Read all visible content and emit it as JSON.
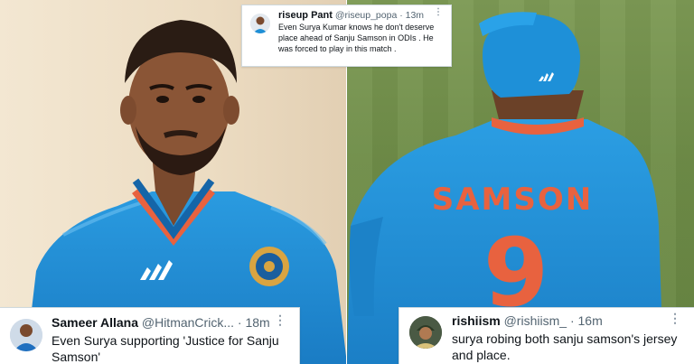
{
  "tweets": {
    "top": {
      "name": "riseup Pant",
      "handle": "@riseup_popa · 13m",
      "body": "Even Surya Kumar knows he don't deserve place ahead of Sanju Samson in ODIs . He was forced to play in this match .",
      "more_icon": "more-dots-icon"
    },
    "bottom_left": {
      "name": "Sameer Allana",
      "handle": "@HitmanCrick...",
      "time": "18m",
      "body": "Even Surya supporting 'Justice for Sanju Samson'",
      "more_icon": "more-dots-icon"
    },
    "bottom_right": {
      "name": "rishiism",
      "handle": "@rishiism_",
      "time": "16m",
      "body": "surya robing both sanju samson's jersey and place.",
      "more_icon": "more-dots-icon"
    }
  },
  "jersey": {
    "name": "SAMSON",
    "number": "9"
  },
  "colors": {
    "jersey_blue": "#1f8fd6",
    "jersey_orange": "#e8623f",
    "pitch_green": "#718f4a",
    "wall_beige": "#eddfc6"
  }
}
